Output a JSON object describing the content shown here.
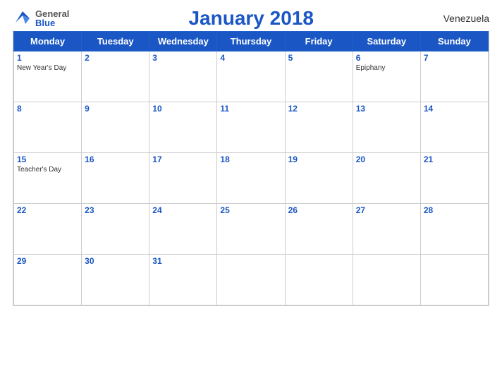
{
  "header": {
    "logo_general": "General",
    "logo_blue": "Blue",
    "title": "January 2018",
    "country": "Venezuela"
  },
  "weekdays": [
    "Monday",
    "Tuesday",
    "Wednesday",
    "Thursday",
    "Friday",
    "Saturday",
    "Sunday"
  ],
  "weeks": [
    [
      {
        "day": "1",
        "holiday": "New Year's Day"
      },
      {
        "day": "2",
        "holiday": ""
      },
      {
        "day": "3",
        "holiday": ""
      },
      {
        "day": "4",
        "holiday": ""
      },
      {
        "day": "5",
        "holiday": ""
      },
      {
        "day": "6",
        "holiday": "Epiphany"
      },
      {
        "day": "7",
        "holiday": ""
      }
    ],
    [
      {
        "day": "8",
        "holiday": ""
      },
      {
        "day": "9",
        "holiday": ""
      },
      {
        "day": "10",
        "holiday": ""
      },
      {
        "day": "11",
        "holiday": ""
      },
      {
        "day": "12",
        "holiday": ""
      },
      {
        "day": "13",
        "holiday": ""
      },
      {
        "day": "14",
        "holiday": ""
      }
    ],
    [
      {
        "day": "15",
        "holiday": "Teacher's Day"
      },
      {
        "day": "16",
        "holiday": ""
      },
      {
        "day": "17",
        "holiday": ""
      },
      {
        "day": "18",
        "holiday": ""
      },
      {
        "day": "19",
        "holiday": ""
      },
      {
        "day": "20",
        "holiday": ""
      },
      {
        "day": "21",
        "holiday": ""
      }
    ],
    [
      {
        "day": "22",
        "holiday": ""
      },
      {
        "day": "23",
        "holiday": ""
      },
      {
        "day": "24",
        "holiday": ""
      },
      {
        "day": "25",
        "holiday": ""
      },
      {
        "day": "26",
        "holiday": ""
      },
      {
        "day": "27",
        "holiday": ""
      },
      {
        "day": "28",
        "holiday": ""
      }
    ],
    [
      {
        "day": "29",
        "holiday": ""
      },
      {
        "day": "30",
        "holiday": ""
      },
      {
        "day": "31",
        "holiday": ""
      },
      {
        "day": "",
        "holiday": ""
      },
      {
        "day": "",
        "holiday": ""
      },
      {
        "day": "",
        "holiday": ""
      },
      {
        "day": "",
        "holiday": ""
      }
    ]
  ]
}
